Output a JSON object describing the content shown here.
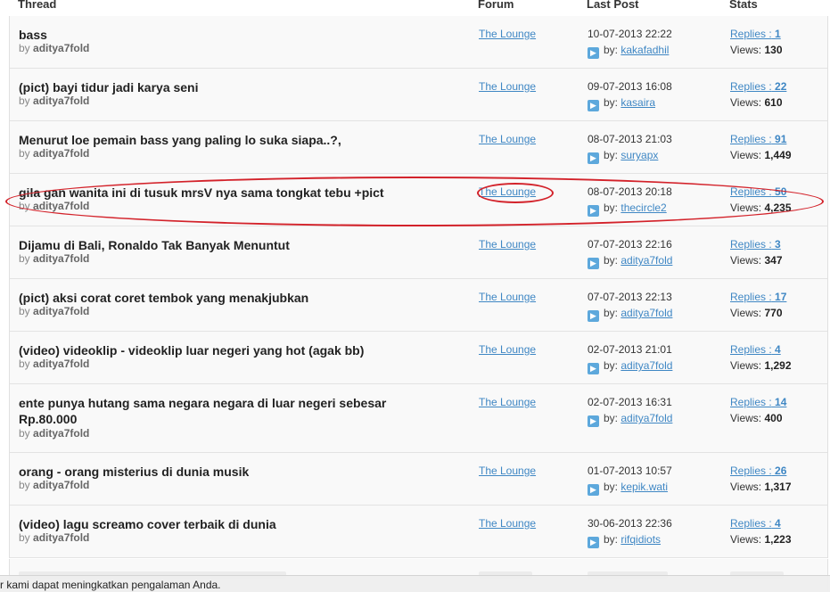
{
  "columns": {
    "thread": "Thread",
    "forum": "Forum",
    "last_post": "Last Post",
    "stats": "Stats"
  },
  "by_prefix": "by",
  "last_by_prefix": "by:",
  "replies_prefix": "Replies :",
  "views_prefix": "Views:",
  "threads": [
    {
      "title": "bass",
      "author": "aditya7fold",
      "forum": "The Lounge",
      "date": "10-07-2013 22:22",
      "last_by": "kakafadhil",
      "replies": "1",
      "views": "130"
    },
    {
      "title": "(pict) bayi tidur jadi karya seni",
      "author": "aditya7fold",
      "forum": "The Lounge",
      "date": "09-07-2013 16:08",
      "last_by": "kasaira",
      "replies": "22",
      "views": "610"
    },
    {
      "title": "Menurut loe pemain bass yang paling lo suka siapa..?,",
      "author": "aditya7fold",
      "forum": "The Lounge",
      "date": "08-07-2013 21:03",
      "last_by": "suryapx",
      "replies": "91",
      "views": "1,449"
    },
    {
      "title": "gila gan wanita ini di tusuk mrsV nya sama tongkat tebu +pict",
      "author": "aditya7fold",
      "forum": "The Lounge",
      "date": "08-07-2013 20:18",
      "last_by": "thecircle2",
      "replies": "50",
      "views": "4,235"
    },
    {
      "title": "Dijamu di Bali, Ronaldo Tak Banyak Menuntut",
      "author": "aditya7fold",
      "forum": "The Lounge",
      "date": "07-07-2013 22:16",
      "last_by": "aditya7fold",
      "replies": "3",
      "views": "347"
    },
    {
      "title": "(pict) aksi corat coret tembok yang menakjubkan",
      "author": "aditya7fold",
      "forum": "The Lounge",
      "date": "07-07-2013 22:13",
      "last_by": "aditya7fold",
      "replies": "17",
      "views": "770"
    },
    {
      "title": "(video) videoklip - videoklip luar negeri yang hot (agak bb)",
      "author": "aditya7fold",
      "forum": "The Lounge",
      "date": "02-07-2013 21:01",
      "last_by": "aditya7fold",
      "replies": "4",
      "views": "1,292"
    },
    {
      "title": "ente punya hutang sama negara negara di luar negeri sebesar Rp.80.000",
      "author": "aditya7fold",
      "forum": "The Lounge",
      "date": "02-07-2013 16:31",
      "last_by": "aditya7fold",
      "replies": "14",
      "views": "400"
    },
    {
      "title": "orang - orang misterius di dunia musik",
      "author": "aditya7fold",
      "forum": "The Lounge",
      "date": "01-07-2013 10:57",
      "last_by": "kepik.wati",
      "replies": "26",
      "views": "1,317"
    },
    {
      "title": "(video) lagu screamo cover terbaik di dunia",
      "author": "aditya7fold",
      "forum": "The Lounge",
      "date": "30-06-2013 22:36",
      "last_by": "rifqidiots",
      "replies": "4",
      "views": "1,223"
    }
  ],
  "cookie_text": "r kami dapat meningkatkan pengalaman Anda.",
  "icons": {
    "last_post": "arrow-right-icon"
  },
  "colors": {
    "link": "#3f87c4",
    "annotation": "#d3222a",
    "row_bg": "#f9f9f9"
  }
}
